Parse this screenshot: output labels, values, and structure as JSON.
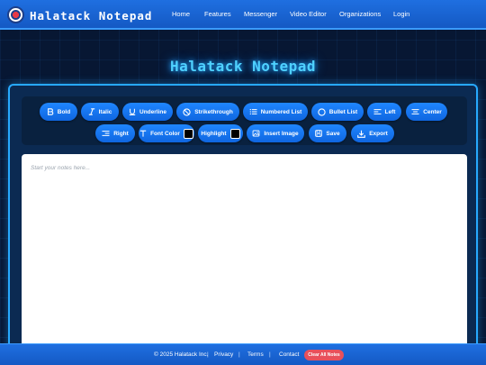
{
  "brand": "Halatack Notepad",
  "nav": {
    "home": "Home",
    "features": "Features",
    "messenger": "Messenger",
    "video_editor": "Video Editor",
    "organizations": "Organizations",
    "login": "Login"
  },
  "title": "Halatack Notepad",
  "toolbar": {
    "bold": "Bold",
    "italic": "Italic",
    "underline": "Underline",
    "strikethrough": "Strikethrough",
    "numbered_list": "Numbered List",
    "bullet_list": "Bullet List",
    "left": "Left",
    "center": "Center",
    "right": "Right",
    "font_color": "Font Color",
    "font_color_value": "#000000",
    "highlight": "Highlight",
    "highlight_value": "#000000",
    "insert_image": "Insert Image",
    "save": "Save",
    "export": "Export"
  },
  "editor": {
    "placeholder": "Start your notes here..."
  },
  "footer": {
    "copyright": "© 2025 Halatack Inc.",
    "privacy": "Privacy",
    "terms": "Terms",
    "contact": "Contact",
    "clear_all": "Clear All Notes"
  },
  "colors": {
    "nav_bg": "#1f6fe0",
    "accent": "#27a9ff",
    "button": "#1f86ff",
    "danger": "#e8505b"
  }
}
